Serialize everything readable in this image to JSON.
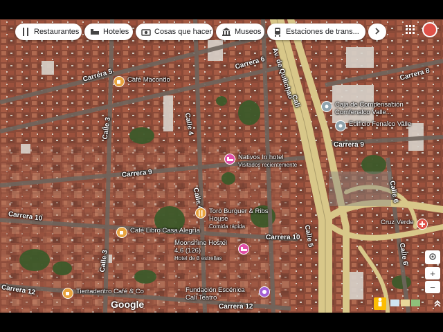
{
  "colors": {
    "poi_orange": "#e8a33d",
    "poi_pink": "#e04fa7",
    "poi_purple": "#a45fd4",
    "poi_grey": "#8fa3ad",
    "poi_red": "#e05249",
    "highway": "#d8c789",
    "chip_bg": "#ffffff"
  },
  "chips": [
    {
      "label": "Restaurantes",
      "icon": "fork-knife-icon"
    },
    {
      "label": "Hoteles",
      "icon": "bed-icon"
    },
    {
      "label": "Cosas que hacer",
      "icon": "camera-icon"
    },
    {
      "label": "Museos",
      "icon": "museum-icon"
    },
    {
      "label": "Estaciones de trans...",
      "icon": "train-icon"
    }
  ],
  "streets": {
    "carrera5": "Carrera 5",
    "carrera6": "Carrera 6",
    "carrera8": "Carrera 8",
    "carrera9_left": "Carrera 9",
    "carrera9_right": "Carrera 9",
    "carrera10_left": "Carrera 10",
    "carrera10_mid": "Carrera 10",
    "carrera12_left": "Carrera 12",
    "carrera12_mid": "Carrera 12",
    "calle3_top": "Calle 3",
    "calle3_bottom": "Calle 3",
    "calle4_top": "Calle 4",
    "calle4_bottom": "Calle 4",
    "calle5": "Calle 5",
    "calle6_a": "Calle 6",
    "calle6_b": "Calle 6",
    "avenida": "Av. de Quilichao",
    "cali": "Cali"
  },
  "pois": [
    {
      "name": "Café Macondo",
      "sub": ""
    },
    {
      "name": "Caja de Compensación",
      "sub": "Comfenalco Valle..."
    },
    {
      "name": "Edificio Fenalco Valle",
      "sub": ""
    },
    {
      "name": "Nativos In hotel",
      "sub": "Visitados recientemente"
    },
    {
      "name": "Toro Burguer & Ribs House",
      "sub": "Comida rápida"
    },
    {
      "name": "Café Libro Casa Alegría",
      "sub": ""
    },
    {
      "name": "Moonshine Hostel 4.6 (126)",
      "sub": "Hotel de 3 estrellas"
    },
    {
      "name": "Fundación Escénica Cali Teatro",
      "sub": ""
    },
    {
      "name": "Tierradentro Café & Co",
      "sub": ""
    },
    {
      "name": "Cruz Verde",
      "sub": ""
    }
  ],
  "brand": "Google",
  "zoom": {
    "in": "+",
    "out": "−"
  }
}
